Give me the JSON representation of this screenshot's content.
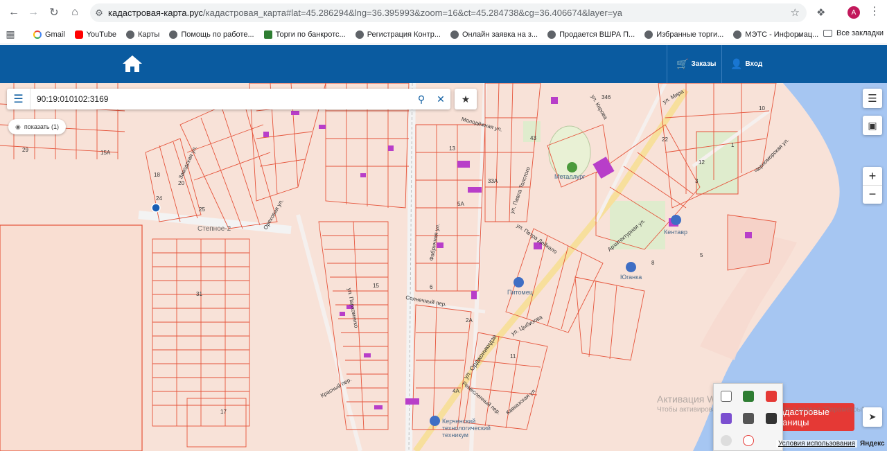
{
  "browser": {
    "url_host": "кадастровая-карта.рус",
    "url_rest": "/кадастровая_карта#lat=45.286294&lng=36.395993&zoom=16&ct=45.284738&cg=36.406674&layer=ya",
    "profile_initial": "A",
    "bookmarks": [
      {
        "label": "Gmail",
        "icon": "gmail-icon"
      },
      {
        "label": "YouTube",
        "icon": "youtube-icon"
      },
      {
        "label": "Карты",
        "icon": "globe-icon"
      },
      {
        "label": "Помощь по работе...",
        "icon": "globe-icon"
      },
      {
        "label": "Торги по банкротс...",
        "icon": "torgi-icon"
      },
      {
        "label": "Регистрация Контр...",
        "icon": "globe-icon"
      },
      {
        "label": "Онлайн заявка на з...",
        "icon": "globe-icon"
      },
      {
        "label": "Продается ВШРА П...",
        "icon": "globe-icon"
      },
      {
        "label": "Избранные торги...",
        "icon": "globe-icon"
      },
      {
        "label": "МЭТС - Информац...",
        "icon": "globe-icon"
      }
    ],
    "bookmarks_more": "»",
    "all_bookmarks": "Все закладки"
  },
  "header": {
    "orders": "Заказы",
    "login": "Вход"
  },
  "search": {
    "value": "90:19:010102:3169",
    "show_label": "показать (1)"
  },
  "map": {
    "streets": [
      "Степное-2",
      "ул. Орджоникидзе",
      "ул. Мира",
      "Черноморская ул.",
      "ул. Кирова",
      "ул. Павла Толстого",
      "ул. Петра Дейкало",
      "Архитектурная ул.",
      "Солнечный пер.",
      "ул. Цыбизова",
      "Ремесленный пер.",
      "Кавказская ул.",
      "Красный пер.",
      "Ореховая ул.",
      "Фабричная ул.",
      "ул. Пархоменко",
      "Молодёжная ул.",
      "Заводская ул."
    ],
    "places": [
      "Металлург",
      "Кентавр",
      "Юганка",
      "Питомец",
      "Керченский технологический техникум"
    ],
    "plot_numbers": [
      "29",
      "15А",
      "24",
      "25",
      "18",
      "20",
      "27",
      "31",
      "15",
      "13",
      "12",
      "11",
      "1",
      "5",
      "4А",
      "2А",
      "6",
      "22",
      "10",
      "3",
      "346",
      "17",
      "8",
      "5А",
      "33А",
      "43"
    ],
    "borders_button": "Кадастровые границы",
    "terms": "Условия использования",
    "brand": "Яндекс"
  },
  "windows_activation": {
    "title": "Активация Windows",
    "subtitle": "Чтобы активировать Windows, перейдите в раздел \"Параметры\""
  },
  "colors": {
    "header_blue": "#0a5ba0",
    "parcel_line": "#e5533a",
    "sea": "#a6c6f2",
    "accent_red": "#e53935"
  }
}
